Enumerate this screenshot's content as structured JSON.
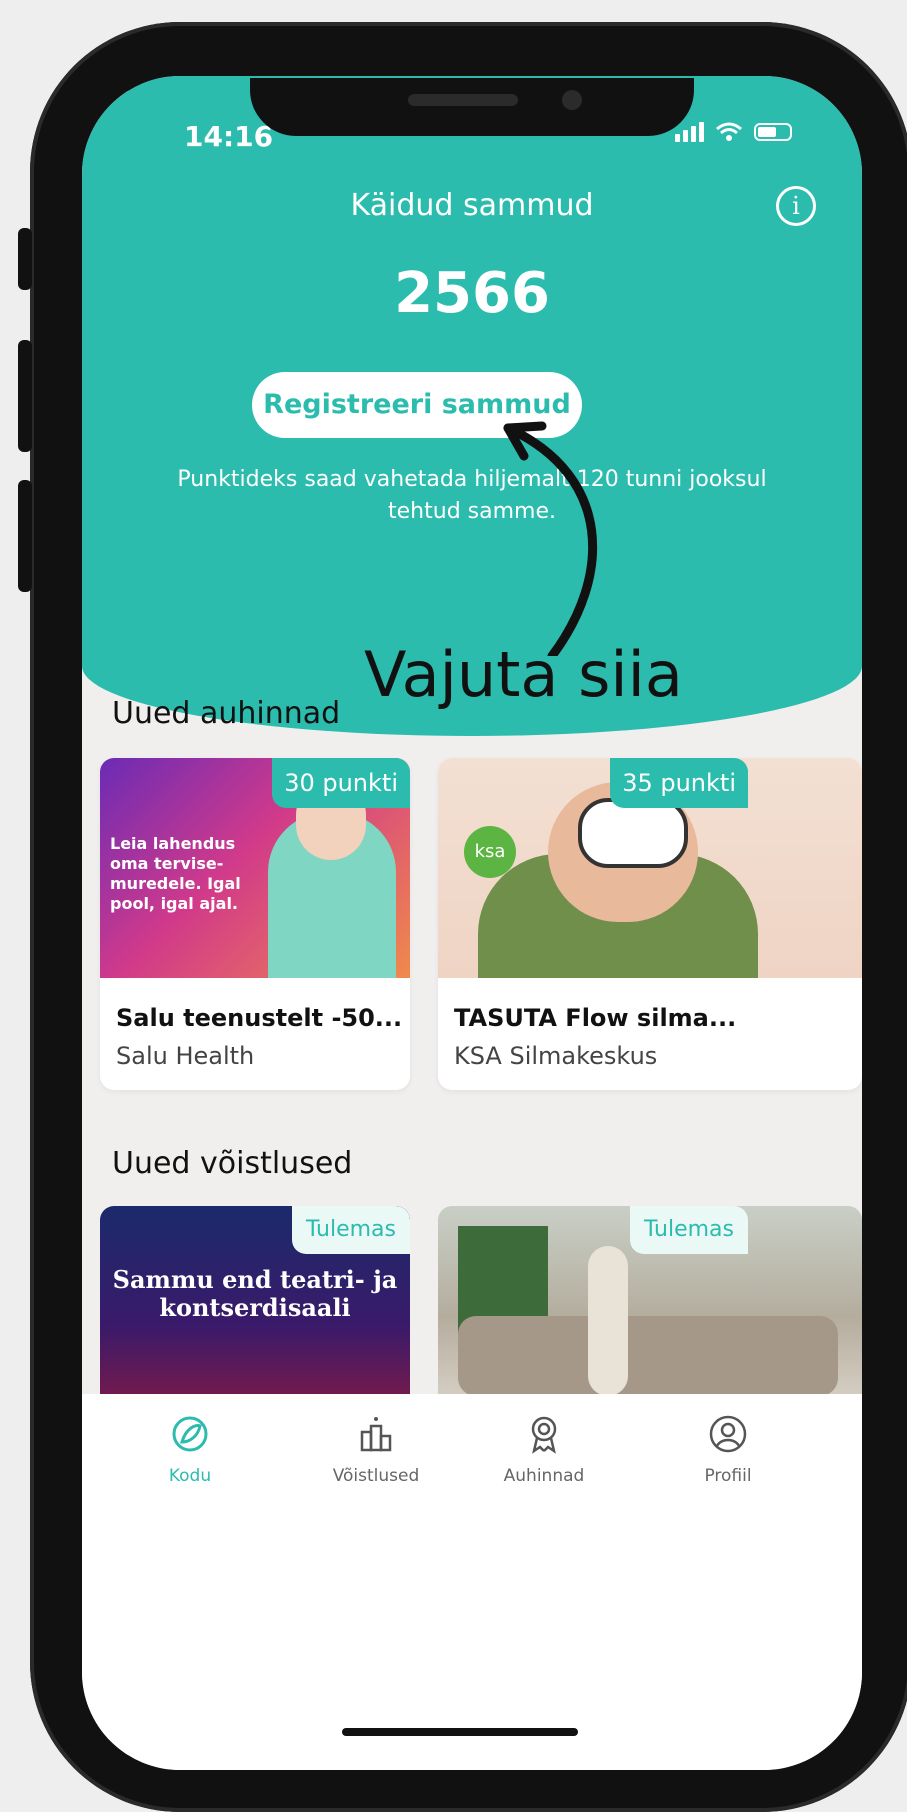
{
  "status_bar": {
    "time": "14:16"
  },
  "hero": {
    "title": "Käidud sammud",
    "steps": "2566",
    "register_button": "Registreeri sammud",
    "note": "Punktideks saad vahetada hiljemalt 120 tunni jooksul tehtud samme."
  },
  "annotation": {
    "text": "Vajuta siia"
  },
  "rewards": {
    "section_title": "Uued auhinnad",
    "items": [
      {
        "badge": "30 punkti",
        "title": "Salu teenustelt -50...",
        "provider": "Salu Health",
        "image_text": "Leia lahendus oma tervise-muredele. Igal pool, igal ajal."
      },
      {
        "badge": "35 punkti",
        "title": "TASUTA Flow silma...",
        "provider": "KSA Silmakeskus",
        "logo_text": "ksa"
      }
    ]
  },
  "competitions": {
    "section_title": "Uued võistlused",
    "items": [
      {
        "badge": "Tulemas",
        "image_text": "Sammu end teatri- ja kontserdisaali"
      },
      {
        "badge": "Tulemas"
      }
    ]
  },
  "tabbar": {
    "items": [
      {
        "label": "Kodu",
        "icon": "leaf-home-icon",
        "active": true
      },
      {
        "label": "Võistlused",
        "icon": "podium-icon",
        "active": false
      },
      {
        "label": "Auhinnad",
        "icon": "award-icon",
        "active": false
      },
      {
        "label": "Profiil",
        "icon": "user-circle-icon",
        "active": false
      }
    ]
  },
  "colors": {
    "accent": "#2bbcae",
    "background": "#f1efee"
  }
}
